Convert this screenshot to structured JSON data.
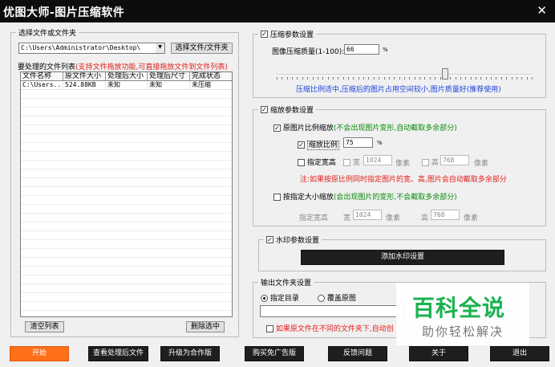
{
  "window": {
    "title": "优图大师-图片压缩软件",
    "close_glyph": "✕"
  },
  "source": {
    "group_title": "选择文件或文件夹",
    "path_value": "C:\\Users\\Administrator\\Desktop\\",
    "dropdown_glyph": "▼",
    "select_button": "选择文件/文件夹",
    "list_label": "要处理的文件列表",
    "list_hint": "(支持文件拖放功能,可直接拖放文件到文件列表)",
    "columns": [
      "文件名称",
      "原文件大小",
      "处理后大小",
      "处理后尺寸",
      "完成状态"
    ],
    "rows": [
      [
        "C:\\Users...",
        "524.88KB",
        "未知",
        "未知",
        "未压缩"
      ]
    ],
    "clear_button": "清空列表",
    "remove_button": "删除选中"
  },
  "compress": {
    "checked_glyph": "✓",
    "group_title": "压缩参数设置",
    "quality_label": "图像压缩质量(1-100):",
    "quality_value": "66",
    "quality_unit": "%",
    "quality_level": 66,
    "hint": "压缩比例适中,压缩后的图片占用空间较小,图片质量好(推荐使用)"
  },
  "scale": {
    "group_title": "缩放参数设置",
    "proportional_label": "原图片比例缩放",
    "proportional_hint": "(不会出现图片变形,自动截取多余部分)",
    "ratio_label": "缩放比例",
    "ratio_value": "75",
    "ratio_unit": "%",
    "wh_label": "指定宽高",
    "width_label": "宽",
    "width_value": "1024",
    "height_label": "高",
    "height_value": "768",
    "pixel_unit": "像素",
    "note": "注:如果按原比例同时指定图片的宽、高,图片会自动截取多余部分",
    "fixed_label": "按指定大小缩放",
    "fixed_hint": "(会出现图片的变形,不会截取多余部分)",
    "fixed_wh_label": "指定宽高",
    "fixed_width_label": "宽",
    "fixed_width_value": "1024",
    "fixed_height_label": "高",
    "fixed_height_value": "768"
  },
  "watermark_settings": {
    "group_title": "水印参数设置",
    "add_button": "添加水印设置"
  },
  "output": {
    "group_title": "输出文件夹设置",
    "option_specified": "指定目录",
    "option_overwrite": "覆盖原图",
    "path_value": "",
    "checkbox_text": "如果原文件在不同的文件夹下,自动创"
  },
  "footer": {
    "start": "开始",
    "view_processed": "查看处理后文件",
    "upgrade": "升级为合作版",
    "buy_adfree": "购买免广告版",
    "feedback": "反馈问题",
    "about": "关于",
    "exit": "退出"
  },
  "overlay_logo": {
    "main": "百科全说",
    "sub": "助你轻松解决"
  },
  "colors": {
    "accent_orange": "#ff6f19",
    "hint_red": "#e0201c",
    "hint_green": "#0a8a0a",
    "hint_blue": "#1a3fe0",
    "logo_green": "#1bb24f"
  }
}
